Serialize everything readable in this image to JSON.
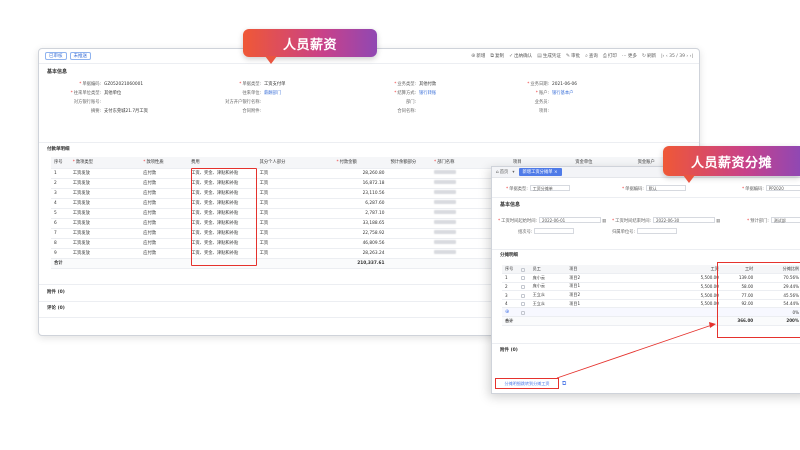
{
  "callouts": {
    "salary": "人员薪资",
    "allocation": "人员薪资分摊"
  },
  "toolbar": {
    "tags": [
      "已审核",
      "未推送"
    ],
    "actions": [
      {
        "icon": "add-icon",
        "label": "新增"
      },
      {
        "icon": "copy-icon",
        "label": "复制"
      },
      {
        "icon": "confirm-icon",
        "label": "出纳确认"
      },
      {
        "icon": "voucher-icon",
        "label": "生成凭证"
      },
      {
        "icon": "approve-icon",
        "label": "审批"
      },
      {
        "icon": "query-icon",
        "label": "查询"
      },
      {
        "icon": "print-icon",
        "label": "打印"
      },
      {
        "icon": "more-icon",
        "label": "更多"
      },
      {
        "icon": "refresh-icon",
        "label": "刷新"
      }
    ],
    "pager": "35 / 39"
  },
  "basic": {
    "title": "基本信息",
    "fields": [
      {
        "label": "单据编码:",
        "value": "GZ052021060001",
        "req": true
      },
      {
        "label": "单据类型:",
        "value": "工资支付单",
        "req": true
      },
      {
        "label": "业务类型:",
        "value": "其他付款",
        "req": true
      },
      {
        "label": "业务日期:",
        "value": "2021-06-06",
        "req": true
      },
      {
        "label": "往来单位类型:",
        "value": "其他单位",
        "req": true
      },
      {
        "label": "往来单位:",
        "value": "薪酬部门",
        "req": false,
        "link": true
      },
      {
        "label": "结算方式:",
        "value": "银行转账",
        "req": true,
        "link": true
      },
      {
        "label": "账户:",
        "value": "银行基本户",
        "req": true,
        "link": true
      },
      {
        "label": "对方银行账号:",
        "value": "",
        "req": false
      },
      {
        "label": "对方开户银行名称:",
        "value": "",
        "req": false
      },
      {
        "label": "部门:",
        "value": "",
        "req": false
      },
      {
        "label": "业务员:",
        "value": "",
        "req": false
      },
      {
        "label": "摘要:",
        "value": "支付东莞城21.7月工资",
        "req": false
      },
      {
        "label": "合同附件:",
        "value": "",
        "req": false
      },
      {
        "label": "合同名称:",
        "value": "",
        "req": false
      },
      {
        "label": "项目:",
        "value": "",
        "req": false
      }
    ]
  },
  "payment": {
    "title": "付款单明细",
    "headers": [
      "序号",
      "款项类型",
      "款项性质",
      "费用",
      "其分个人部分",
      "付款金额",
      "预计余额部分",
      "部门名称",
      "项目",
      "资金单位",
      "资金账户"
    ],
    "req_cols": [
      1,
      2,
      5,
      7
    ],
    "rows": [
      [
        "1",
        "工资发放",
        "应付款",
        "工资、奖金、津贴和补贴",
        "工资",
        "28,260.80"
      ],
      [
        "2",
        "工资发放",
        "应付款",
        "工资、奖金、津贴和补贴",
        "工资",
        "16,872.18"
      ],
      [
        "3",
        "工资发放",
        "应付款",
        "工资、奖金、津贴和补贴",
        "工资",
        "23,110.56"
      ],
      [
        "4",
        "工资发放",
        "应付款",
        "工资、奖金、津贴和补贴",
        "工资",
        "6,287.60"
      ],
      [
        "5",
        "工资发放",
        "应付款",
        "工资、奖金、津贴和补贴",
        "工资",
        "2,787.10"
      ],
      [
        "6",
        "工资发放",
        "应付款",
        "工资、奖金、津贴和补贴",
        "工资",
        "33,188.65"
      ],
      [
        "7",
        "工资发放",
        "应付款",
        "工资、奖金、津贴和补贴",
        "工资",
        "22,758.92"
      ],
      [
        "8",
        "工资发放",
        "应付款",
        "工资、奖金、津贴和补贴",
        "工资",
        "46,809.56"
      ],
      [
        "9",
        "工资发放",
        "应付款",
        "工资、奖金、津贴和补贴",
        "工资",
        "28,263.24"
      ]
    ],
    "total_label": "合计",
    "total_value": "210,337.61"
  },
  "attachment": "附件 (0)",
  "comment": "评论 (0)",
  "alloc": {
    "home": "首页",
    "tab": "新增工资分摊单",
    "top_fields": [
      {
        "label": "单据类型:",
        "value": "工资分摊单"
      },
      {
        "label": "单据编码:",
        "value": "默认"
      },
      {
        "label": "单据编码:",
        "value": "PP2020"
      }
    ],
    "basic_title": "基本信息",
    "basic_fields": [
      {
        "label": "工资时间起始时间:",
        "value": "2022-06-01"
      },
      {
        "label": "工资时间结束时间:",
        "value": "2022-06-30"
      },
      {
        "label": "预计部门:",
        "value": "测试部"
      },
      {
        "label": "组次号:",
        "value": ""
      },
      {
        "label": "归属单位号:",
        "value": ""
      }
    ],
    "detail_title": "分摊明细",
    "headers": [
      "序号",
      "员工",
      "项目",
      "工资",
      "工时",
      "分摊比例"
    ],
    "rows": [
      [
        "1",
        "庞小云",
        "项目2",
        "5,500.00",
        "139.00",
        "70.56%"
      ],
      [
        "2",
        "庞小云",
        "项目1",
        "5,500.00",
        "58.00",
        "29.44%"
      ],
      [
        "3",
        "王立众",
        "项目2",
        "5,500.00",
        "77.00",
        "45.56%"
      ],
      [
        "4",
        "王立众",
        "项目1",
        "5,500.00",
        "92.00",
        "54.44%"
      ],
      [
        "5",
        "",
        "",
        "",
        "",
        "0%"
      ]
    ],
    "total_label": "合计",
    "total_hours": "366.00",
    "total_ratio": "200%",
    "attachment": "附件 (0)",
    "link_text": "分摊明细跳转到分摊工资"
  }
}
